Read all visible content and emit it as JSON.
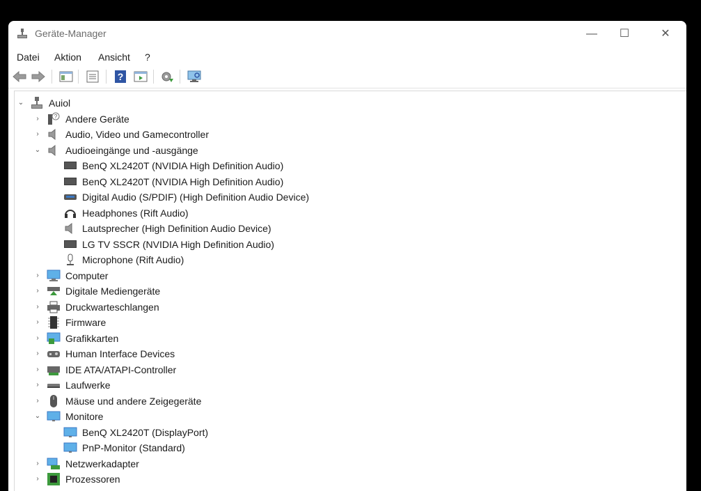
{
  "window": {
    "title": "Geräte-Manager",
    "controls": {
      "minimize": "—",
      "maximize": "☐",
      "close": "✕"
    }
  },
  "menu": {
    "file": "Datei",
    "action": "Aktion",
    "view": "Ansicht",
    "help": "?"
  },
  "tree": {
    "root": "Auiol",
    "items": {
      "andere": "Andere Geräte",
      "audio_video": "Audio, Video und Gamecontroller",
      "audioeingaenge": "Audioeingänge und -ausgänge",
      "benq_audio_1": "BenQ XL2420T (NVIDIA High Definition Audio)",
      "benq_audio_2": "BenQ XL2420T (NVIDIA High Definition Audio)",
      "digital_audio": "Digital Audio (S/PDIF) (High Definition Audio Device)",
      "headphones": "Headphones (Rift Audio)",
      "lautsprecher": "Lautsprecher (High Definition Audio Device)",
      "lg_tv": "LG TV SSCR (NVIDIA High Definition Audio)",
      "microphone": "Microphone (Rift Audio)",
      "computer": "Computer",
      "digitale_medien": "Digitale Mediengeräte",
      "druck": "Druckwarteschlangen",
      "firmware": "Firmware",
      "grafik": "Grafikkarten",
      "hid": "Human Interface Devices",
      "ide": "IDE ATA/ATAPI-Controller",
      "laufwerke": "Laufwerke",
      "maeuse": "Mäuse und andere Zeigegeräte",
      "monitore": "Monitore",
      "benq_dp": "BenQ XL2420T (DisplayPort)",
      "pnp": "PnP-Monitor (Standard)",
      "netzwerk": "Netzwerkadapter",
      "prozessoren": "Prozessoren"
    }
  }
}
